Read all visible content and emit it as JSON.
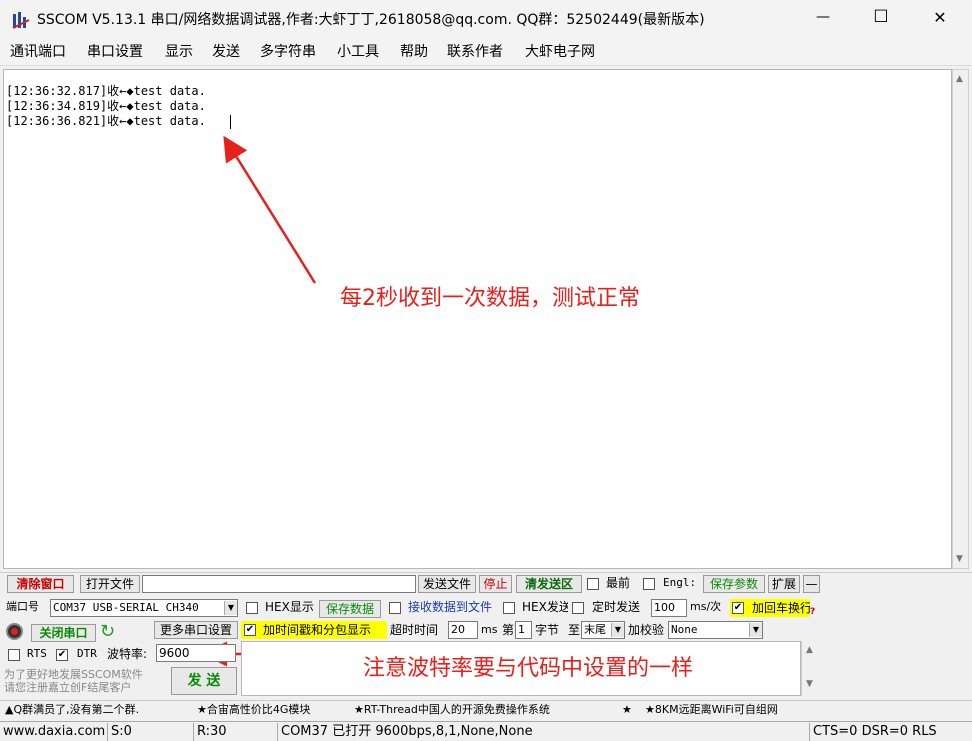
{
  "window": {
    "title": "SSCOM V5.13.1 串口/网络数据调试器,作者:大虾丁丁,2618058@qq.com. QQ群：52502449(最新版本)",
    "minimize_glyph": "—",
    "maximize_glyph": "☐",
    "close_glyph": "✕"
  },
  "menu": [
    "通讯端口",
    "串口设置",
    "显示",
    "发送",
    "多字符串",
    "小工具",
    "帮助",
    "联系作者",
    "大虾电子网"
  ],
  "receive": {
    "lines": [
      "[12:36:32.817]收←◆test data.",
      "[12:36:34.819]收←◆test data.",
      "[12:36:36.821]收←◆test data."
    ]
  },
  "annotations": {
    "note1": "每2秒收到一次数据，测试正常",
    "note2": "注意波特率要与代码中设置的一样",
    "color": "#e8201b"
  },
  "toolbar1": {
    "clear_window": "清除窗口",
    "open_file": "打开文件",
    "send_file": "发送文件",
    "stop": "停止",
    "clear_send_area": "清发送区",
    "last": "最前",
    "engl": "Engl:",
    "save_params": "保存参数",
    "expand": "扩展",
    "dash": "—"
  },
  "port": {
    "port_label": "端口号",
    "port_value": "COM37 USB-SERIAL CH340",
    "close_port": "关闭串口",
    "more_settings": "更多串口设置",
    "rts": "RTS",
    "dtr": "DTR",
    "baud_label": "波特率:",
    "baud_value": "9600",
    "promo": "为了更好地发展SSCOM软件\n请您注册嘉立创F结尾客户",
    "send": "发 送"
  },
  "options": {
    "hex_display": "HEX显示",
    "save_data": "保存数据",
    "recv_to_file": "接收数据到文件",
    "hex_send": "HEX发送",
    "timed_send": "定时发送",
    "interval_value": "100",
    "interval_unit": "ms/次",
    "add_crlf": "加回车换行",
    "timestamp": "加时间戳和分包显示",
    "timeout_label": "超时时间",
    "timeout_value": "20",
    "timeout_unit": "ms",
    "nth_label": "第",
    "nth_value": "1",
    "byte_label": "字节",
    "to_label": "至",
    "to_value": "末尾",
    "checksum_label": "加校验",
    "checksum_value": "None"
  },
  "ticker": [
    "▲Q群满员了,没有第二个群.",
    "★合宙高性价比4G模块",
    "★RT-Thread中国人的开源免费操作系统",
    "★",
    "★8KM远距离WiFi可自组网"
  ],
  "status": {
    "site": "www.daxia.com",
    "sent": "S:0",
    "received": "R:30",
    "port_state": "COM37 已打开  9600bps,8,1,None,None",
    "signals": "CTS=0 DSR=0 RLS"
  }
}
